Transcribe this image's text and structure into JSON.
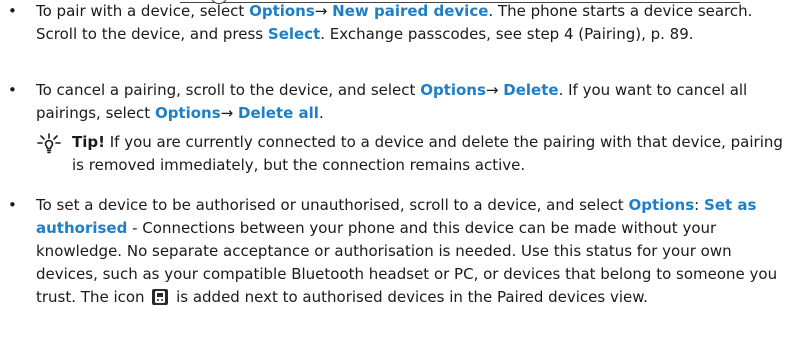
{
  "items": {
    "pair": {
      "t1": "To pair with a device, select ",
      "k1": "Options",
      "arrow": "→",
      "k2": "New paired device",
      "t2": ". The phone starts a device search. Scroll to the device, and press ",
      "k3": "Select",
      "t3": ". Exchange passcodes, see step 4 (Pairing), p. 89."
    },
    "cancel": {
      "t1": "To cancel a pairing, scroll to the device, and select ",
      "k1": "Options",
      "arrow1": "→",
      "k2": "Delete",
      "t2": ". If you want to cancel all pairings, select ",
      "k3": "Options",
      "arrow2": "→",
      "k4": "Delete all",
      "t3": "."
    },
    "authorise": {
      "t1": "To set a device to be authorised or unauthorised, scroll to a device, and select ",
      "k1": "Options",
      "colon": ":",
      "k2": "Set as authorised",
      "t2": " - Connections between your phone and this device can be made without your knowledge. No separate acceptance or authorisation is needed. Use this status for your own devices, such as your compatible Bluetooth headset or PC, or devices that belong to someone you trust. The icon ",
      "t3": " is added next to authorised devices in the Paired devices view."
    }
  },
  "tip": {
    "label": "Tip!",
    "text": " If you are currently connected to a device and delete the pairing with that device, pairing is removed immediately, but the connection remains active."
  },
  "bullet": "•",
  "icons": {
    "tip": "tip-lightbulb-icon",
    "authorised": "authorised-device-icon"
  },
  "colors": {
    "keyword": "#1e7fc8",
    "text": "#1a1a1a"
  }
}
